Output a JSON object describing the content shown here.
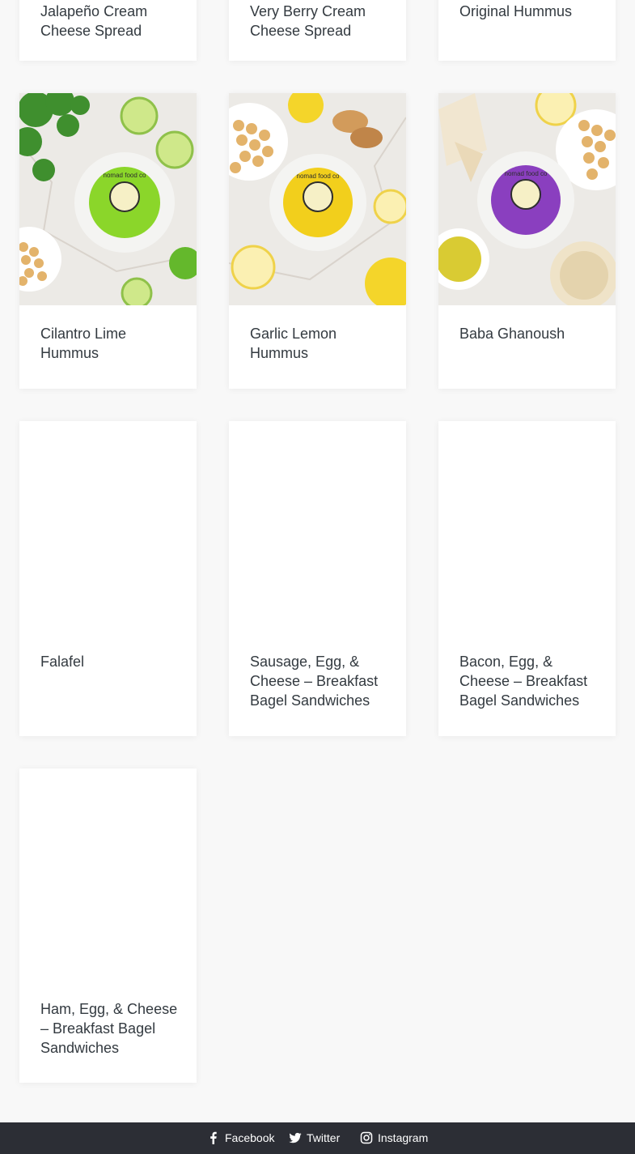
{
  "products_row1": [
    {
      "title": "Jalapeño Cream Cheese Spread"
    },
    {
      "title": "Very Berry Cream Cheese Spread"
    },
    {
      "title": "Original Hummus"
    }
  ],
  "products_row2": [
    {
      "title": "Cilantro Lime Hummus",
      "image_label": "nomad food co",
      "accent": "#8bd62a"
    },
    {
      "title": "Garlic Lemon Hummus",
      "image_label": "nomad food co",
      "accent": "#f2cf1c"
    },
    {
      "title": "Baba Ghanoush",
      "image_label": "nomad food co",
      "accent": "#8a3fbf"
    }
  ],
  "products_row3": [
    {
      "title": "Falafel"
    },
    {
      "title": "Sausage, Egg, & Cheese – Breakfast Bagel Sandwiches"
    },
    {
      "title": "Bacon, Egg, & Cheese – Breakfast Bagel Sandwiches"
    }
  ],
  "products_row4": [
    {
      "title": "Ham, Egg, & Cheese – Breakfast Bagel Sandwiches"
    }
  ],
  "footer": {
    "social": [
      {
        "label": "Facebook",
        "icon": "facebook-icon"
      },
      {
        "label": "Twitter",
        "icon": "twitter-icon"
      },
      {
        "label": "Instagram",
        "icon": "instagram-icon"
      }
    ]
  },
  "colors": {
    "footer_bg": "#2c2e35",
    "page_bg": "#f8f8f8",
    "text": "#333a40"
  }
}
